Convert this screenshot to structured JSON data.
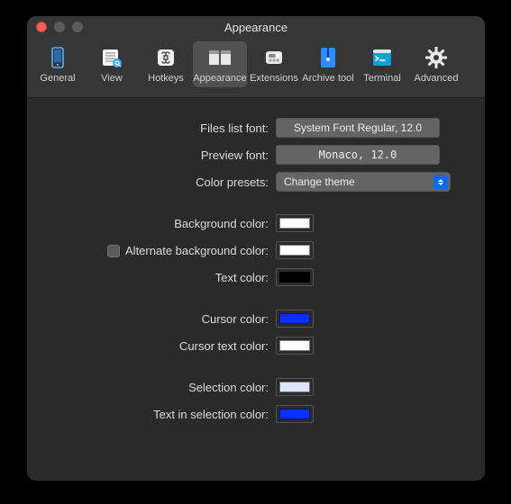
{
  "window": {
    "title": "Appearance"
  },
  "toolbar": {
    "items": [
      {
        "label": "General"
      },
      {
        "label": "View"
      },
      {
        "label": "Hotkeys"
      },
      {
        "label": "Appearance"
      },
      {
        "label": "Extensions"
      },
      {
        "label": "Archive tool"
      },
      {
        "label": "Terminal"
      },
      {
        "label": "Advanced"
      }
    ],
    "selected": "Appearance"
  },
  "form": {
    "files_list_font": {
      "label": "Files list font:",
      "value": "System Font Regular, 12.0"
    },
    "preview_font": {
      "label": "Preview font:",
      "value": "Monaco, 12.0"
    },
    "color_presets": {
      "label": "Color presets:",
      "value": "Change theme"
    },
    "background": {
      "label": "Background color:",
      "color": "#ffffff"
    },
    "alt_background": {
      "label": "Alternate background color:",
      "checked": false,
      "color": "#ffffff"
    },
    "text": {
      "label": "Text color:",
      "color": "#000000"
    },
    "cursor": {
      "label": "Cursor color:",
      "color": "#0a2fff"
    },
    "cursor_text": {
      "label": "Cursor text color:",
      "color": "#ffffff"
    },
    "selection": {
      "label": "Selection color:",
      "color": "#dfe6ff"
    },
    "text_in_selection": {
      "label": "Text in selection color:",
      "color": "#0a2fff"
    }
  }
}
